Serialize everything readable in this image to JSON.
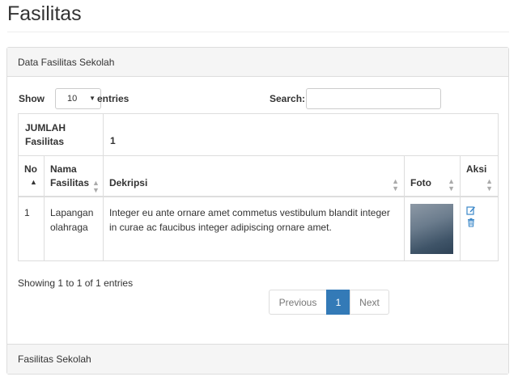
{
  "page": {
    "title": "Fasilitas"
  },
  "panel": {
    "heading": "Data Fasilitas Sekolah",
    "footer": "Fasilitas Sekolah"
  },
  "controls": {
    "show_label": "Show",
    "length_value": "10",
    "entries_label": "entries",
    "search_label": "Search:",
    "search_value": ""
  },
  "summary": {
    "label": "JUMLAH Fasilitas",
    "value": "1"
  },
  "table": {
    "columns": [
      "No",
      "Nama Fasilitas",
      "Dekripsi",
      "Foto",
      "Aksi"
    ],
    "rows": [
      {
        "no": "1",
        "nama": "Lapangan olahraga",
        "deskripsi": "Integer eu ante ornare amet commetus vestibulum blandit integer in curae ac faucibus integer adipiscing ornare amet.",
        "foto": "photo-thumbnail"
      }
    ]
  },
  "info": "Showing 1 to 1 of 1 entries",
  "pagination": {
    "previous": "Previous",
    "current": "1",
    "next": "Next"
  },
  "icons": {
    "sort": "sort-icon",
    "sort_asc": "sort-asc-icon",
    "edit": "edit-icon",
    "delete": "trash-icon",
    "dropdown": "chevron-down-icon"
  },
  "colors": {
    "primary": "#337ab7",
    "action_icon": "#3a87c8",
    "panel_bg": "#f5f5f5",
    "border": "#dddddd"
  }
}
